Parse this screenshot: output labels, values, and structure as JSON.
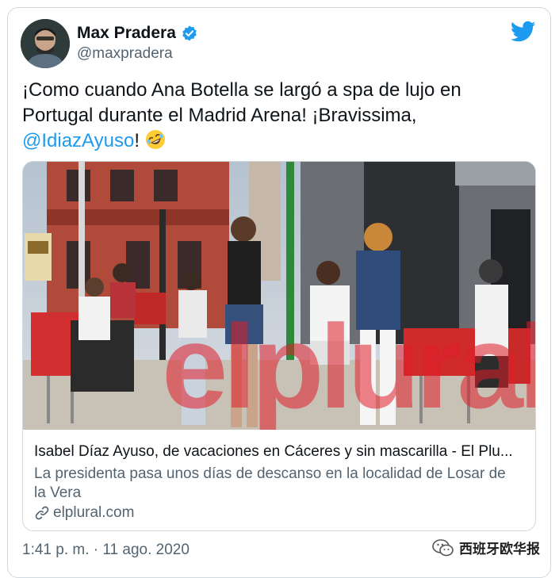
{
  "author": {
    "name": "Max Pradera",
    "handle": "@maxpradera"
  },
  "tweet": {
    "text_part1": "¡Como cuando Ana Botella se largó a spa de lujo en Portugal durante el Madrid Arena!  ¡Bravissima, ",
    "mention": "@IdiazAyuso",
    "text_part2": "! ",
    "emoji": "rolling-on-floor-laughing"
  },
  "link_card": {
    "image_overlay_text": "elplural",
    "title": "Isabel Díaz Ayuso, de vacaciones en Cáceres y sin mascarilla - El Plu...",
    "description": "La presidenta pasa unos días de descanso en la localidad de Losar de la Vera",
    "domain": "elplural.com"
  },
  "timestamp": "1:41 p. m. · 11 ago. 2020",
  "watermark": "西班牙欧华报",
  "colors": {
    "accent": "#1d9bf0",
    "secondary_text": "#536471",
    "border": "#cfd9de"
  },
  "icons": [
    "verified-badge-icon",
    "twitter-bird-icon",
    "link-icon",
    "wechat-watermark-icon"
  ]
}
